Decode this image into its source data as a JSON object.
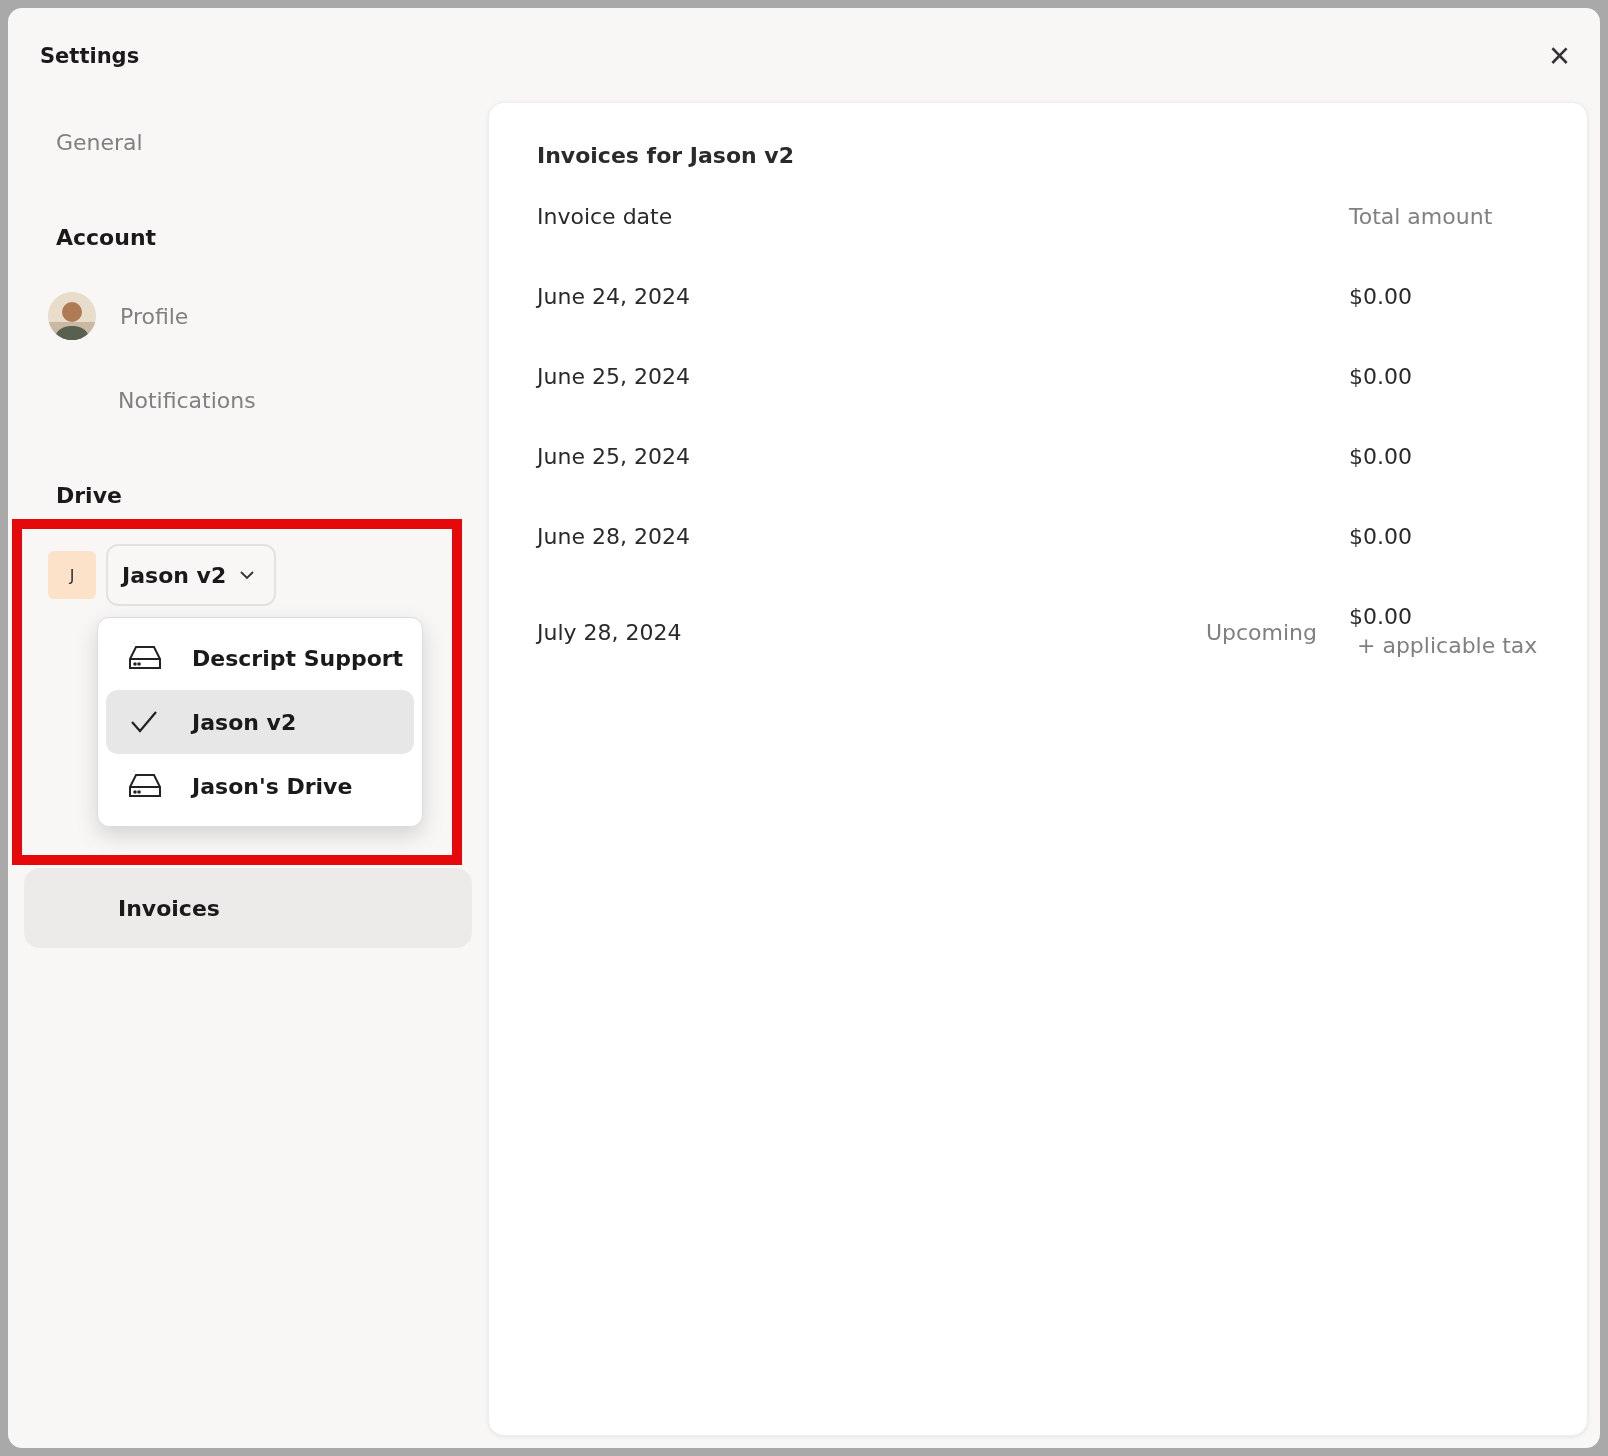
{
  "window": {
    "title": "Settings",
    "close": "×"
  },
  "sidebar": {
    "items": [
      {
        "kind": "link",
        "label": "General",
        "selected": false
      },
      {
        "kind": "heading",
        "label": "Account"
      },
      {
        "kind": "profile",
        "label": "Profile",
        "selected": false
      },
      {
        "kind": "link",
        "label": "Notifications",
        "selected": false
      },
      {
        "kind": "heading",
        "label": "Drive"
      },
      {
        "kind": "drive",
        "initial": "J",
        "label": "Jason v2",
        "menu": [
          {
            "label": "Descript Support",
            "selected": false
          },
          {
            "label": "Jason v2",
            "selected": true
          },
          {
            "label": "Jason's Drive",
            "selected": false
          }
        ]
      },
      {
        "kind": "link",
        "label": "Invoices",
        "selected": true
      }
    ]
  },
  "invoices": {
    "title": "Invoices for Jason v2",
    "columns": [
      "Invoice date",
      "Total amount"
    ],
    "rows": [
      {
        "date": "June 24, 2024",
        "amount": "$0.00"
      },
      {
        "date": "June 25, 2024",
        "amount": "$0.00"
      },
      {
        "date": "June 25, 2024",
        "amount": "$0.00"
      },
      {
        "date": "June 28, 2024",
        "amount": "$0.00"
      },
      {
        "date": "July 28, 2024",
        "status": "Upcoming",
        "amount": "$0.00",
        "note": "+ applicable tax"
      }
    ]
  }
}
